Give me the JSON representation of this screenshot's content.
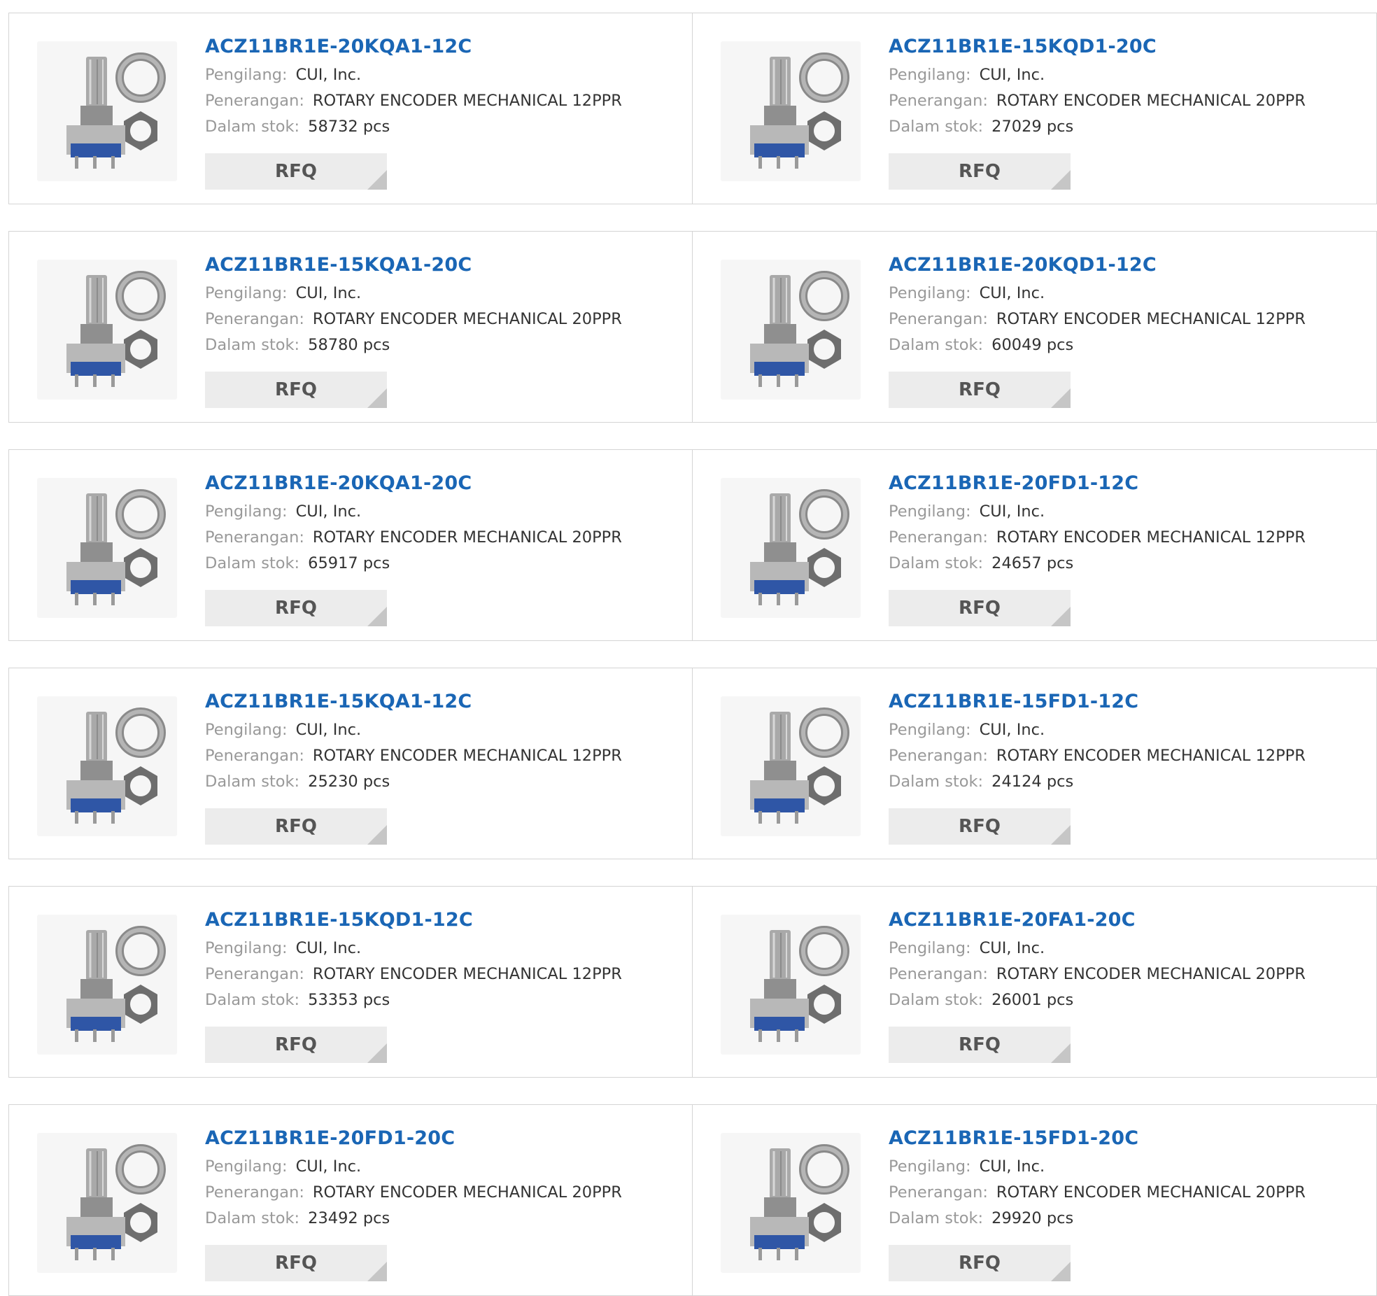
{
  "labels": {
    "manufacturer": "Pengilang:",
    "description": "Penerangan:",
    "stock": "Dalam stok:",
    "rfq": "RFQ"
  },
  "colors": {
    "link": "#1a66b5",
    "label": "#999999",
    "value": "#333333",
    "button_bg": "#ececec"
  },
  "products": [
    {
      "part": "ACZ11BR1E-20KQA1-12C",
      "manufacturer": "CUI, Inc.",
      "description": "ROTARY ENCODER MECHANICAL 12PPR",
      "stock": "58732 pcs",
      "image": "rotary-encoder-knurled-shaft-with-nut-washer"
    },
    {
      "part": "ACZ11BR1E-15KQD1-20C",
      "manufacturer": "CUI, Inc.",
      "description": "ROTARY ENCODER MECHANICAL 20PPR",
      "stock": "27029 pcs",
      "image": "rotary-encoder-angled-knurled-shaft"
    },
    {
      "part": "ACZ11BR1E-15KQA1-20C",
      "manufacturer": "CUI, Inc.",
      "description": "ROTARY ENCODER MECHANICAL 20PPR",
      "stock": "58780 pcs",
      "image": "rotary-encoder-knurled-shaft-with-nut-washer"
    },
    {
      "part": "ACZ11BR1E-20KQD1-12C",
      "manufacturer": "CUI, Inc.",
      "description": "ROTARY ENCODER MECHANICAL 12PPR",
      "stock": "60049 pcs",
      "image": "rotary-encoder-knurled-shaft-vertical"
    },
    {
      "part": "ACZ11BR1E-20KQA1-20C",
      "manufacturer": "CUI, Inc.",
      "description": "ROTARY ENCODER MECHANICAL 20PPR",
      "stock": "65917 pcs",
      "image": "rotary-encoder-split-shaft"
    },
    {
      "part": "ACZ11BR1E-20FD1-12C",
      "manufacturer": "CUI, Inc.",
      "description": "ROTARY ENCODER MECHANICAL 12PPR",
      "stock": "24657 pcs",
      "image": "rotary-encoder-black-shaft"
    },
    {
      "part": "ACZ11BR1E-15KQA1-12C",
      "manufacturer": "CUI, Inc.",
      "description": "ROTARY ENCODER MECHANICAL 12PPR",
      "stock": "25230 pcs",
      "image": "rotary-encoder-knurled-shaft-angled"
    },
    {
      "part": "ACZ11BR1E-15FD1-12C",
      "manufacturer": "CUI, Inc.",
      "description": "ROTARY ENCODER MECHANICAL 12PPR",
      "stock": "24124 pcs",
      "image": "rotary-encoder-horizontal-smooth-shaft"
    },
    {
      "part": "ACZ11BR1E-15KQD1-12C",
      "manufacturer": "CUI, Inc.",
      "description": "ROTARY ENCODER MECHANICAL 12PPR",
      "stock": "53353 pcs",
      "image": "rotary-encoder-black-knurled-shaft"
    },
    {
      "part": "ACZ11BR1E-20FA1-20C",
      "manufacturer": "CUI, Inc.",
      "description": "ROTARY ENCODER MECHANICAL 20PPR",
      "stock": "26001 pcs",
      "image": "rotary-encoder-horizontal-smooth-shaft"
    },
    {
      "part": "ACZ11BR1E-20FD1-20C",
      "manufacturer": "CUI, Inc.",
      "description": "ROTARY ENCODER MECHANICAL 20PPR",
      "stock": "23492 pcs",
      "image": "rotary-encoder-smooth-shaft-with-nut-washer"
    },
    {
      "part": "ACZ11BR1E-15FD1-20C",
      "manufacturer": "CUI, Inc.",
      "description": "ROTARY ENCODER MECHANICAL 20PPR",
      "stock": "29920 pcs",
      "image": "rotary-encoder-black-shaft"
    }
  ]
}
